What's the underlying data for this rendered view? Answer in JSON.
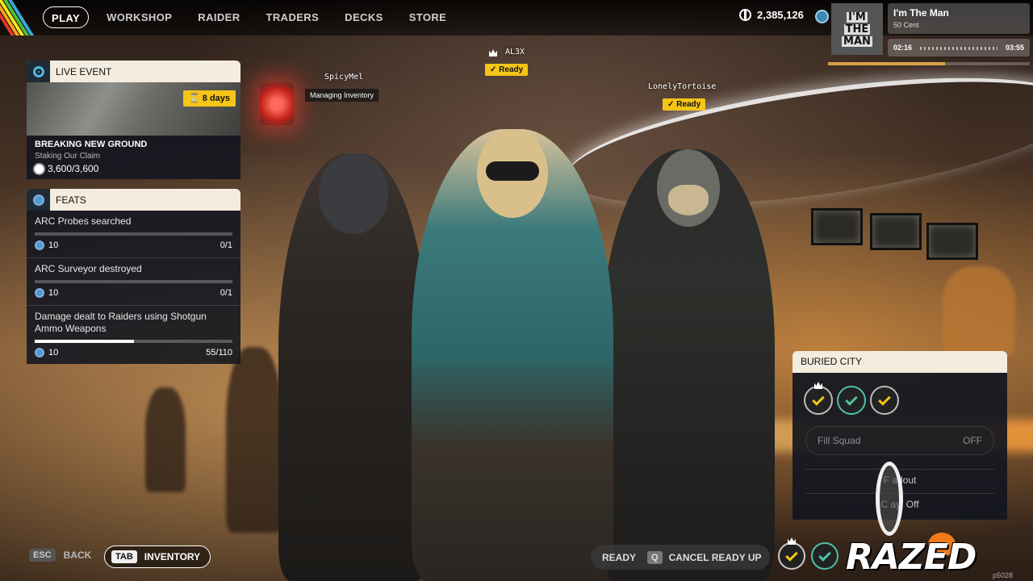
{
  "nav": {
    "items": [
      {
        "label": "PLAY",
        "active": true
      },
      {
        "label": "WORKSHOP",
        "active": false
      },
      {
        "label": "RAIDER",
        "active": false
      },
      {
        "label": "TRADERS",
        "active": false
      },
      {
        "label": "DECKS",
        "active": false
      },
      {
        "label": "STORE",
        "active": false
      }
    ],
    "currency": "2,385,126",
    "currency_icon": "coin-icon",
    "token_icon": "token-icon"
  },
  "music": {
    "album_text": [
      "I'M",
      "THE",
      "MAN"
    ],
    "title": "I'm The Man",
    "artist": "50 Cent",
    "elapsed": "02:16",
    "duration": "03:55",
    "progress_fraction": 0.58
  },
  "live_event": {
    "header": "LIVE EVENT",
    "days_left": "8 days",
    "title": "BREAKING NEW GROUND",
    "subtitle": "Staking Our Claim",
    "progress": "3,600/3,600"
  },
  "feats": {
    "header": "FEATS",
    "items": [
      {
        "name": "ARC Probes searched",
        "reward": "10",
        "progress": "0/1",
        "fraction": 0
      },
      {
        "name": "ARC Surveyor destroyed",
        "reward": "10",
        "progress": "0/1",
        "fraction": 0
      },
      {
        "name": "Damage dealt to Raiders using Shotgun Ammo Weapons",
        "reward": "10",
        "progress": "55/110",
        "fraction": 0.5
      }
    ]
  },
  "squad": {
    "left": {
      "name": "SpicyMel",
      "status": "Managing Inventory"
    },
    "center": {
      "name": "AL3X",
      "status": "Ready"
    },
    "right": {
      "name": "LonelyTortoise",
      "status": "Ready"
    }
  },
  "map_panel": {
    "title": "BURIED CITY",
    "fill_squad_label": "Fill Squad",
    "fill_squad_value": "OFF",
    "loadout_label": "F      adout",
    "crossplay_label": "C           ay: Off"
  },
  "bottom": {
    "back_key": "ESC",
    "back_label": "BACK",
    "inventory_key": "TAB",
    "inventory_label": "INVENTORY",
    "ready_label": "READY",
    "cancel_key": "Q",
    "cancel_label": "CANCEL READY UP"
  },
  "watermark": {
    "logo": "RAZED",
    "build": "p5028"
  },
  "colors": {
    "accent_yellow": "#f5c518",
    "panel_header": "#f3ecdf",
    "panel_body": "#121620",
    "stripes": [
      "#e8352b",
      "#f5a623",
      "#f8e71c",
      "#4ec13a",
      "#3aa6dd"
    ]
  }
}
